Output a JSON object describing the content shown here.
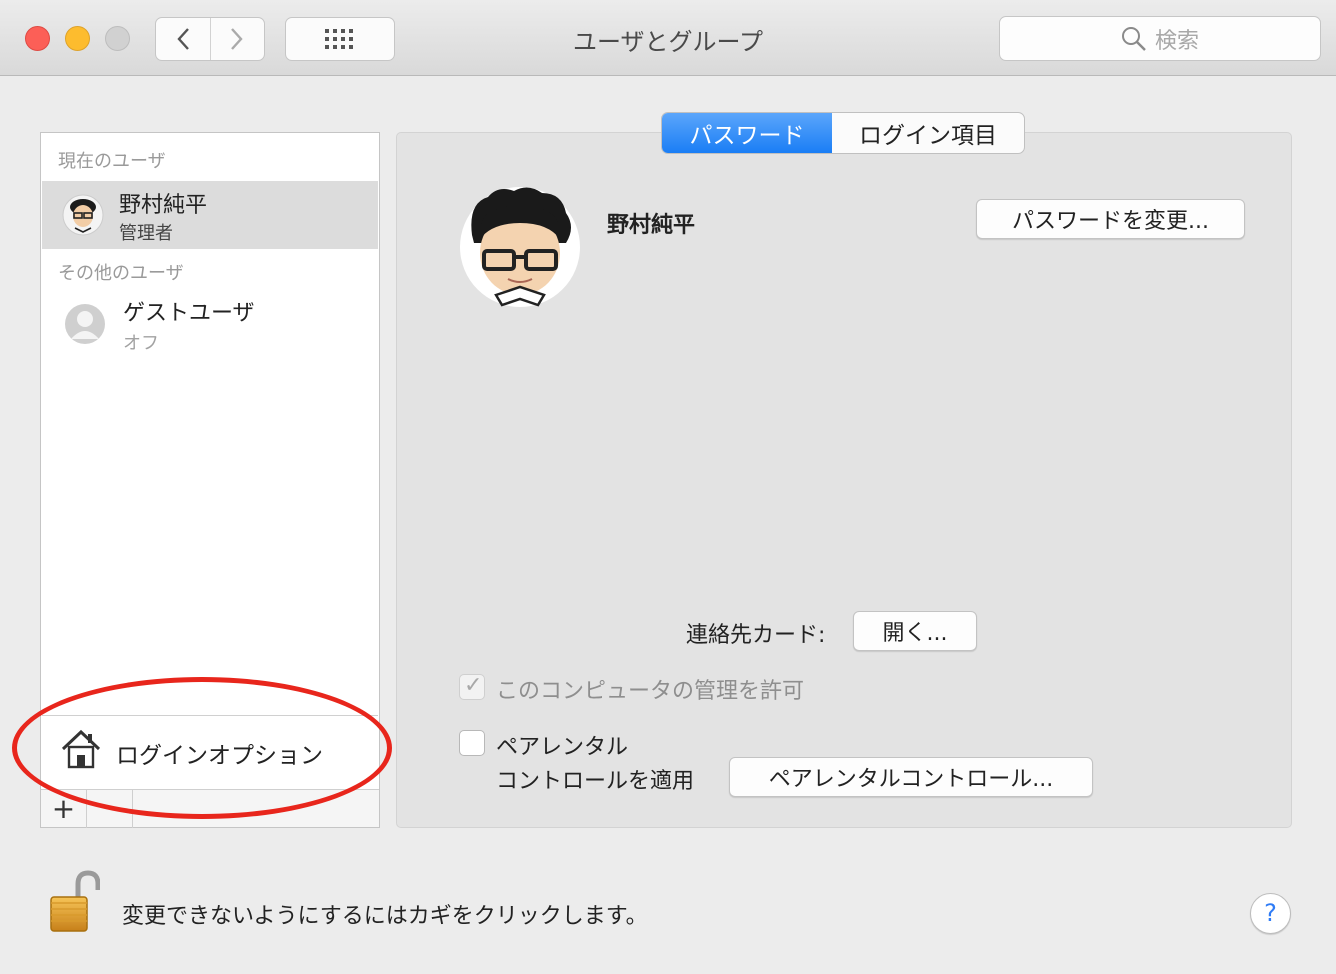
{
  "window": {
    "title": "ユーザとグループ",
    "search_placeholder": "検索",
    "icons": [
      "chevron-left-icon",
      "chevron-right-icon",
      "grid-icon",
      "search-icon"
    ]
  },
  "sidebar": {
    "current_header": "現在のユーザ",
    "current_user": {
      "name": "野村純平",
      "role": "管理者"
    },
    "other_header": "その他のユーザ",
    "other_users": [
      {
        "name": "ゲストユーザ",
        "status": "オフ"
      }
    ],
    "login_options": "ログインオプション",
    "add_label": "+"
  },
  "tabs": [
    {
      "label": "パスワード",
      "active": true
    },
    {
      "label": "ログイン項目",
      "active": false
    }
  ],
  "user_panel": {
    "name": "野村純平",
    "change_password_button": "パスワードを変更...",
    "contact_card_label": "連絡先カード:",
    "open_button": "開く...",
    "admin_checkbox": {
      "label": "このコンピュータの管理を許可",
      "checked": true,
      "disabled": true
    },
    "parental_checkbox": {
      "label_line1": "ペアレンタル",
      "label_line2": "コントロールを適用",
      "checked": false
    },
    "parental_button": "ペアレンタルコントロール..."
  },
  "footer": {
    "lock_text": "変更できないようにするにはカギをクリックします。",
    "help_label": "?"
  },
  "colors": {
    "accent": "#1a7ef5",
    "annotation": "#e8261c"
  }
}
